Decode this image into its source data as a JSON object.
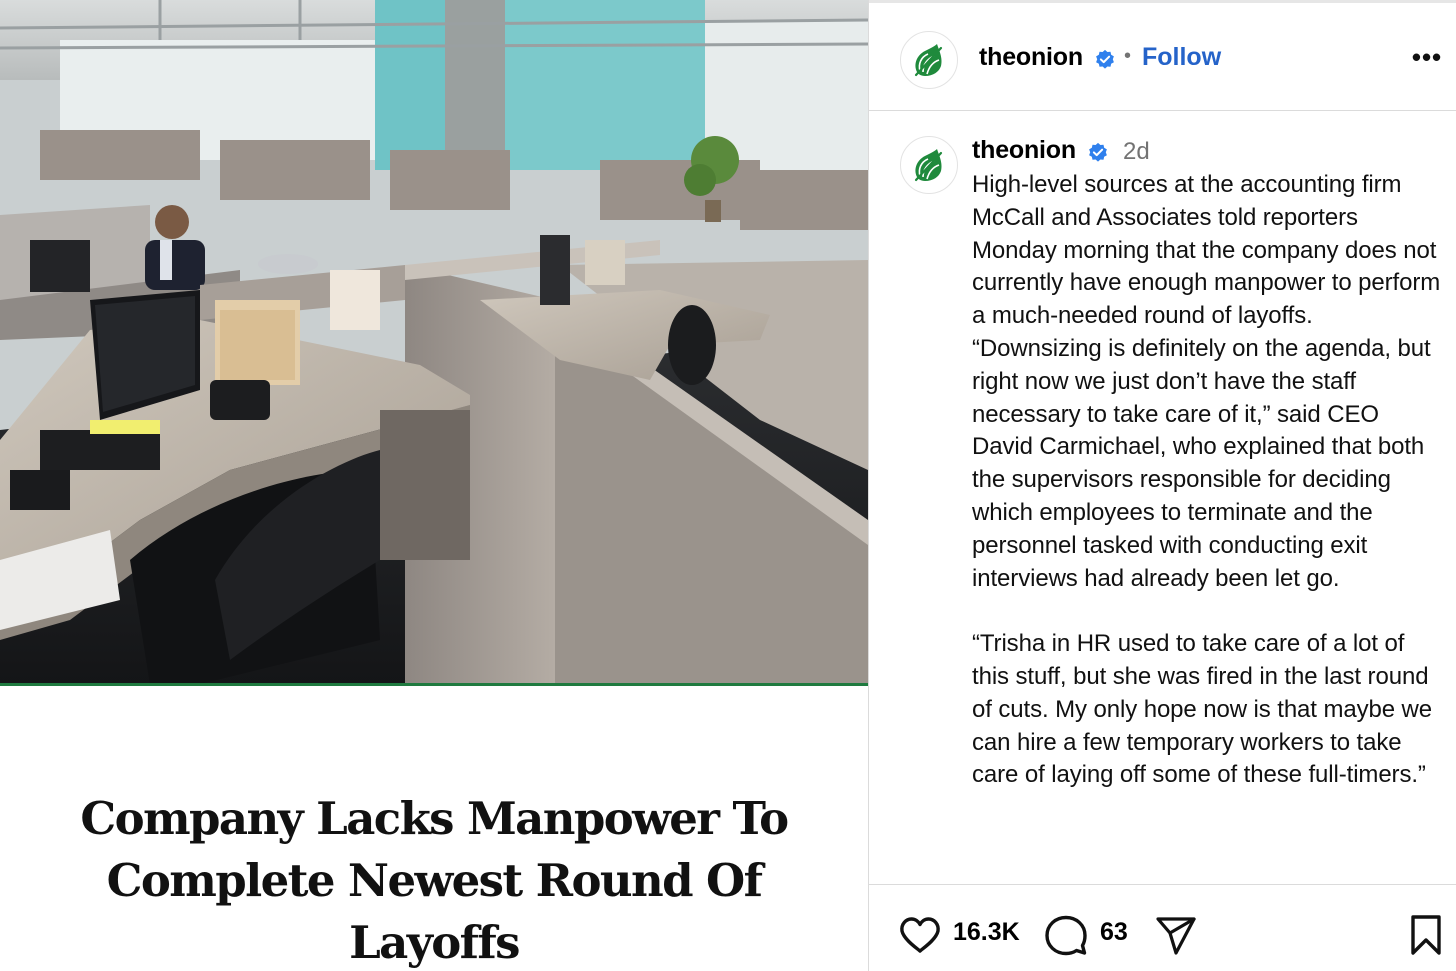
{
  "article": {
    "headline_line1": "Company Lacks Manpower To",
    "headline_line2": "Complete Newest Round Of Layoffs",
    "image_subject": "office-cubicles-photo"
  },
  "post": {
    "account": "theonion",
    "follow_label": "Follow",
    "separator": "•",
    "more_label": "•••",
    "age": "2d",
    "caption_paragraph_1": "High-level sources at the accounting firm McCall and Associates told reporters Monday morning that the company does not currently have enough manpower to perform a much-needed round of layoffs. “Downsizing is definitely on the agenda, but right now we just don’t have the staff necessary to take care of it,” said CEO David Carmichael, who explained that both the supervisors responsible for deciding which employees to terminate and the personnel tasked with conducting exit interviews had already been let go.",
    "caption_paragraph_2": "“Trisha in HR used to take care of a lot of this stuff, but she was fired in the last round of cuts. My only hope now is that maybe we can hire a few temporary workers to take care of laying off some of these full-timers.”",
    "likes": "16.3K",
    "comments": "63"
  },
  "icons": {
    "avatar": "onion-logo-icon",
    "verified": "verified-badge-icon",
    "like": "heart-icon",
    "comment": "comment-bubble-icon",
    "share": "paper-plane-icon",
    "save": "bookmark-icon",
    "more": "more-options-icon"
  },
  "colors": {
    "follow_link": "#2563c9",
    "verified_badge": "#2f80ed",
    "onion_green": "#1f8a3c",
    "muted_text": "#737373",
    "divider": "#dbdbdb"
  }
}
